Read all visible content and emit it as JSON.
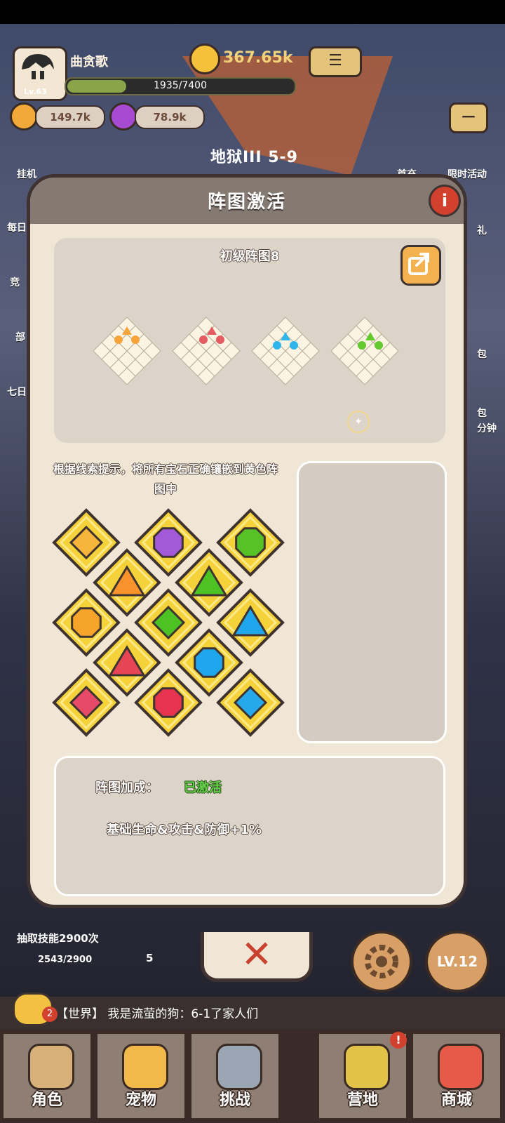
{
  "hud": {
    "player_name": "曲贪歌",
    "level": "Lv.63",
    "xp": "1935/7400",
    "xp_ratio": 0.26,
    "gold": "367.65k",
    "resource_1": "149.7k",
    "resource_2": "78.9k",
    "stage": "地狱III 5-9"
  },
  "side_menu": {
    "left_items": [
      "挂机",
      "每日",
      "竞",
      "部",
      "七日"
    ],
    "right_items": [
      "首充",
      "限时活动",
      "礼",
      "包",
      "包",
      "分钟"
    ]
  },
  "modal": {
    "title": "阵图激活",
    "puzzle_title": "初级阵图8",
    "hint": "根据线索提示，将所有宝石正确镶嵌到黄色阵图中",
    "bonus_label": "阵图加成：",
    "bonus_status": "已激活",
    "bonus_effect": "基础生命&攻击&防御+1%",
    "close_symbol": "✕"
  },
  "gems": [
    {
      "shape": "diamond",
      "color": "#f7b43a"
    },
    {
      "shape": "octagon",
      "color": "#a35ad9"
    },
    {
      "shape": "octagon",
      "color": "#56c226"
    },
    {
      "shape": "triangle",
      "color": "#f7932a"
    },
    {
      "shape": "triangle",
      "color": "#4dc223"
    },
    {
      "shape": "octagon",
      "color": "#f7a52a"
    },
    {
      "shape": "diamond",
      "color": "#4dc223"
    },
    {
      "shape": "triangle",
      "color": "#1fa6ec"
    },
    {
      "shape": "triangle",
      "color": "#e64553"
    },
    {
      "shape": "octagon",
      "color": "#1fa6ec"
    },
    {
      "shape": "diamond",
      "color": "#e64a66"
    },
    {
      "shape": "octagon",
      "color": "#e6344f"
    },
    {
      "shape": "diamond",
      "color": "#25a9ec"
    }
  ],
  "clue_colors": [
    "#f7a53a",
    "#e65a62",
    "#2eb6ec",
    "#62c92f"
  ],
  "bottom_hud": {
    "skill_text": "抽取技能2900次",
    "skill_progress": "2543/2900",
    "count": "5",
    "level_button": "LV.12"
  },
  "chat": {
    "channel": "【世界】",
    "message": "我是流萤的狗：6-1了家人们",
    "unread": "2"
  },
  "nav": [
    {
      "label": "角色"
    },
    {
      "label": "宠物"
    },
    {
      "label": "挑战"
    },
    {
      "label": "营地"
    },
    {
      "label": "商城"
    }
  ],
  "nav_badge": "!"
}
